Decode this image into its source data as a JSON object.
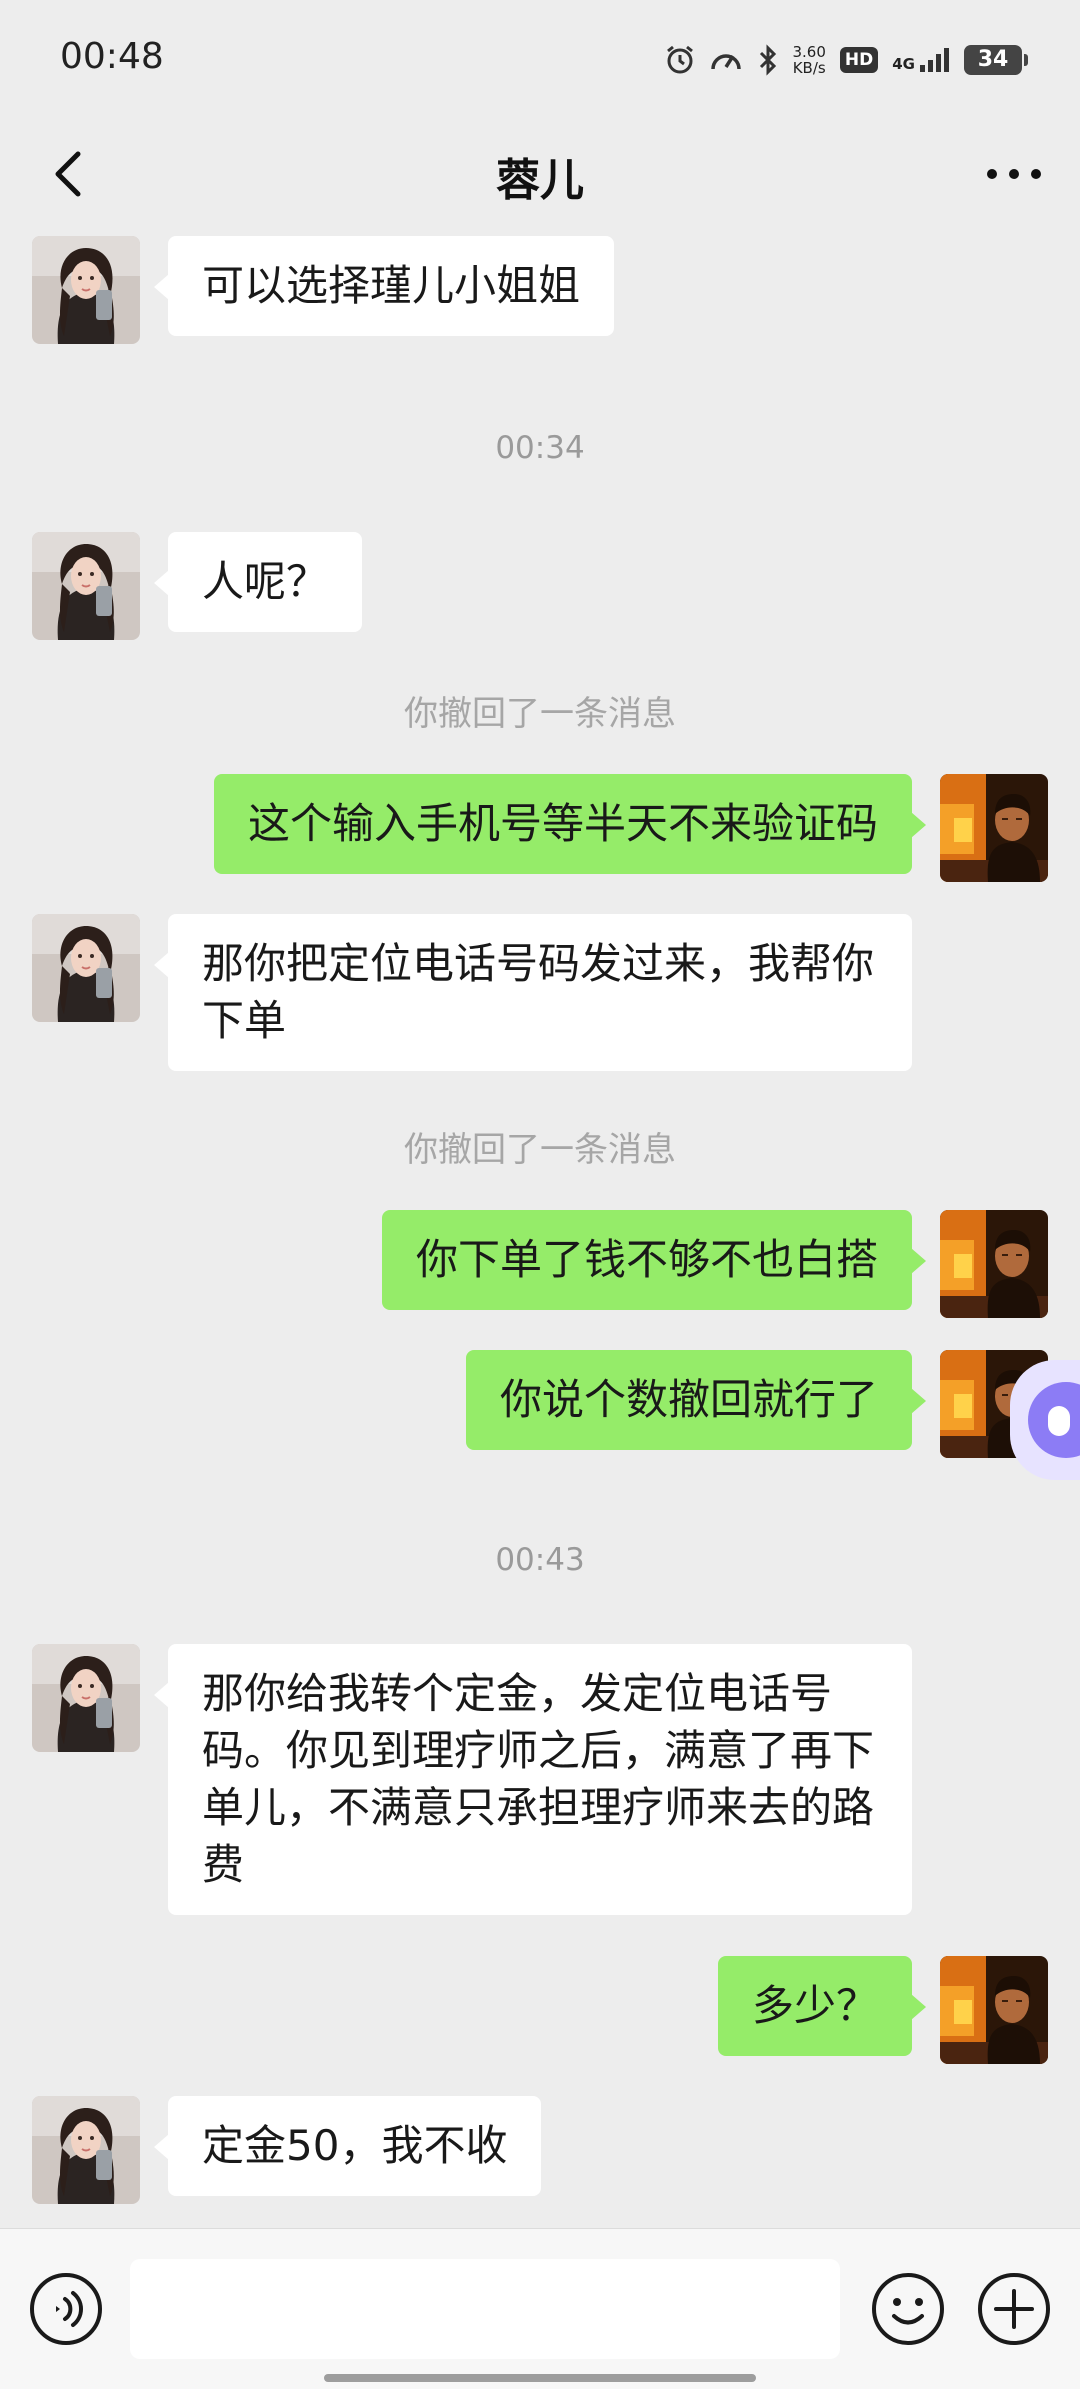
{
  "status_bar": {
    "time": "00:48",
    "speed_value": "3.60",
    "speed_unit": "KB/s",
    "hd_label": "HD",
    "network_label": "4G",
    "battery": "34",
    "icons": [
      "alarm-icon",
      "speedometer-icon",
      "bluetooth-icon",
      "signal-icon"
    ]
  },
  "nav": {
    "title": "蓉儿",
    "back_icon": "chevron-left-icon",
    "more_icon": "more-dots-icon"
  },
  "chat": {
    "contact_avatar": "contact-avatar-woman",
    "my_avatar": "my-avatar-man",
    "messages": [
      {
        "type": "received",
        "text": "可以选择瑾儿小姐姐"
      },
      {
        "type": "time",
        "text": "00:34"
      },
      {
        "type": "received",
        "text": "人呢？"
      },
      {
        "type": "system",
        "text": "你撤回了一条消息"
      },
      {
        "type": "sent",
        "text": "这个输入手机号等半天不来验证码"
      },
      {
        "type": "received",
        "text": "那你把定位电话号码发过来，我帮你下单"
      },
      {
        "type": "system",
        "text": "你撤回了一条消息"
      },
      {
        "type": "sent",
        "text": "你下单了钱不够不也白搭"
      },
      {
        "type": "sent",
        "text": "你说个数撤回就行了"
      },
      {
        "type": "time",
        "text": "00:43"
      },
      {
        "type": "received",
        "text": "那你给我转个定金，发定位电话号码。你见到理疗师之后，满意了再下单儿，不满意只承担理疗师来去的路费"
      },
      {
        "type": "sent",
        "text": "多少？"
      },
      {
        "type": "received",
        "text": "定金50，我不收"
      }
    ]
  },
  "input_bar": {
    "value": "",
    "voice_icon": "voice-icon",
    "emoji_icon": "emoji-icon",
    "plus_icon": "plus-icon"
  },
  "colors": {
    "background": "#ededed",
    "sent_bubble": "#95ec69",
    "received_bubble": "#ffffff",
    "meta_text": "#9a9a9a"
  }
}
